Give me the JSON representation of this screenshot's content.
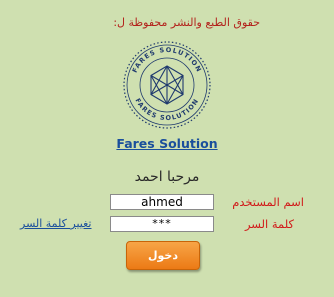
{
  "copyright_text": "حقوق الطبع والنشر محفوظة ل:",
  "logo": {
    "icon": "hexagon-network-logo-icon",
    "ring_text_top": "FARES SOLUTION",
    "ring_text_bottom": "FARES SOLUTION"
  },
  "brand_link": "Fares Solution",
  "welcome": "مرحبا احمد",
  "form": {
    "username_label": "اسم المستخدم",
    "username_value": "ahmed",
    "password_label": "كلمة السر",
    "password_value": "***",
    "change_password_link": "تغيير كلمة السر",
    "login_button": "دخول"
  },
  "colors": {
    "background": "#cfe0b0",
    "label_red": "#d11a1a",
    "link_blue": "#1a4f9c",
    "button_orange": "#ec7a15",
    "logo_navy": "#1f3a6e"
  }
}
